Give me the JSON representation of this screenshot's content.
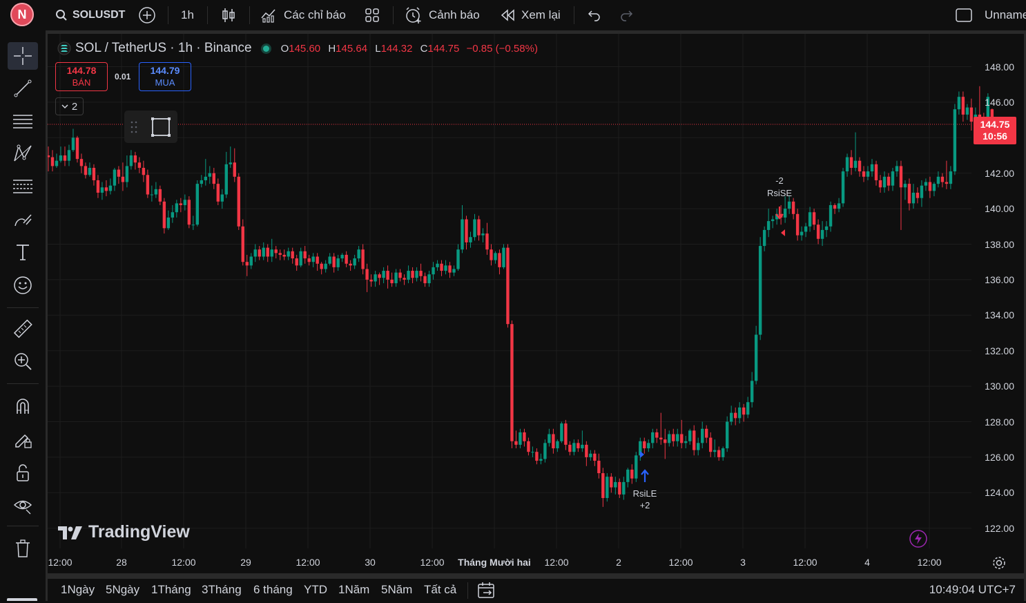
{
  "topbar": {
    "avatar_letter": "N",
    "symbol": "SOLUSDT",
    "interval": "1h",
    "indicators_label": "Các chỉ báo",
    "alerts_label": "Cảnh báo",
    "replay_label": "Xem lại",
    "layout_name": "Unname"
  },
  "legend": {
    "title": "SOL / TetherUS · 1h · Binance",
    "o_key": "O",
    "o_val": "145.60",
    "h_key": "H",
    "h_val": "145.64",
    "l_key": "L",
    "l_val": "144.32",
    "c_key": "C",
    "c_val": "144.75",
    "change": "−0.85 (−0.58%)"
  },
  "trade": {
    "sell_price": "144.78",
    "sell_label": "BÁN",
    "spread": "0.01",
    "buy_price": "144.79",
    "buy_label": "MUA",
    "indicator_count": "2"
  },
  "colors": {
    "up": "#089981",
    "down": "#f23645",
    "background": "#0f0f0f",
    "accent": "#2962ff"
  },
  "chart_data": {
    "type": "candlestick",
    "symbol": "SOL / TetherUS",
    "interval": "1h",
    "exchange": "Binance",
    "ylim": [
      121,
      149.5
    ],
    "y_ticks": [
      "148.00",
      "146.00",
      "144.00",
      "142.00",
      "140.00",
      "138.00",
      "136.00",
      "134.00",
      "132.00",
      "130.00",
      "128.00",
      "126.00",
      "124.00",
      "122.00"
    ],
    "x_ticks": [
      "12:00",
      "28",
      "12:00",
      "29",
      "12:00",
      "30",
      "12:00",
      "Tháng Mười hai",
      "12:00",
      "2",
      "12:00",
      "3",
      "12:00",
      "4",
      "12:00"
    ],
    "last_price": "144.75",
    "countdown": "10:56",
    "candles": [
      [
        143.0,
        142.9,
        142.1,
        143.5
      ],
      [
        142.9,
        142.4,
        142.1,
        143.3
      ],
      [
        142.4,
        142.7,
        142.3,
        143.1
      ],
      [
        142.7,
        143.0,
        142.6,
        143.5
      ],
      [
        143.0,
        142.7,
        142.4,
        143.5
      ],
      [
        142.7,
        143.3,
        142.4,
        143.6
      ],
      [
        143.3,
        144.0,
        143.2,
        144.5
      ],
      [
        144.0,
        142.8,
        142.6,
        144.1
      ],
      [
        142.8,
        142.4,
        142.0,
        143.1
      ],
      [
        142.4,
        141.9,
        141.7,
        142.6
      ],
      [
        141.9,
        142.3,
        141.8,
        142.6
      ],
      [
        142.3,
        141.6,
        141.3,
        142.5
      ],
      [
        141.6,
        140.9,
        140.6,
        141.9
      ],
      [
        140.9,
        141.2,
        140.5,
        141.5
      ],
      [
        141.2,
        141.0,
        140.7,
        141.6
      ],
      [
        141.0,
        141.3,
        140.8,
        141.7
      ],
      [
        141.3,
        142.2,
        141.0,
        142.3
      ],
      [
        142.2,
        141.8,
        141.4,
        142.4
      ],
      [
        141.8,
        141.5,
        141.0,
        142.6
      ],
      [
        141.5,
        142.4,
        141.2,
        143.0
      ],
      [
        142.4,
        143.0,
        142.2,
        143.3
      ],
      [
        143.0,
        142.6,
        142.2,
        143.2
      ],
      [
        142.6,
        142.3,
        142.0,
        142.9
      ],
      [
        142.3,
        141.9,
        141.5,
        142.7
      ],
      [
        141.9,
        140.8,
        140.6,
        142.2
      ],
      [
        140.8,
        140.8,
        140.4,
        141.3
      ],
      [
        140.8,
        141.1,
        140.6,
        141.5
      ],
      [
        141.1,
        140.4,
        140.2,
        141.3
      ],
      [
        140.4,
        138.9,
        138.6,
        140.6
      ],
      [
        138.9,
        139.5,
        138.8,
        139.9
      ],
      [
        139.5,
        139.8,
        139.2,
        140.2
      ],
      [
        139.8,
        140.3,
        139.5,
        140.5
      ],
      [
        140.3,
        140.2,
        139.8,
        140.6
      ],
      [
        140.2,
        140.5,
        139.9,
        140.8
      ],
      [
        140.5,
        139.1,
        138.9,
        140.7
      ],
      [
        139.1,
        139.1,
        138.8,
        139.6
      ],
      [
        139.1,
        141.4,
        139.0,
        141.6
      ],
      [
        141.4,
        141.6,
        141.2,
        141.9
      ],
      [
        141.6,
        141.8,
        141.3,
        142.8
      ],
      [
        141.8,
        142.0,
        141.4,
        142.4
      ],
      [
        142.0,
        141.4,
        141.1,
        142.3
      ],
      [
        141.4,
        140.4,
        140.2,
        141.7
      ],
      [
        140.4,
        140.8,
        140.0,
        141.1
      ],
      [
        140.8,
        142.5,
        140.6,
        143.2
      ],
      [
        142.5,
        142.6,
        142.3,
        143.5
      ],
      [
        142.6,
        141.8,
        141.5,
        143.4
      ],
      [
        141.8,
        139.0,
        138.8,
        142.0
      ],
      [
        139.0,
        137.0,
        136.8,
        139.4
      ],
      [
        137.0,
        136.8,
        136.2,
        137.4
      ],
      [
        136.8,
        137.3,
        136.6,
        137.5
      ],
      [
        137.3,
        137.7,
        137.0,
        138.0
      ],
      [
        137.7,
        137.3,
        137.1,
        137.9
      ],
      [
        137.3,
        137.8,
        137.1,
        138.1
      ],
      [
        137.8,
        137.3,
        137.0,
        138.0
      ],
      [
        137.3,
        137.7,
        137.0,
        138.3
      ],
      [
        137.7,
        137.5,
        137.2,
        137.9
      ],
      [
        137.5,
        137.4,
        137.1,
        137.7
      ],
      [
        137.4,
        137.3,
        137.1,
        137.7
      ],
      [
        137.3,
        137.6,
        137.1,
        137.8
      ],
      [
        137.6,
        137.2,
        136.9,
        137.8
      ],
      [
        137.2,
        136.8,
        136.5,
        137.4
      ],
      [
        136.8,
        137.6,
        136.7,
        137.8
      ],
      [
        137.6,
        137.2,
        136.9,
        137.9
      ],
      [
        137.2,
        137.0,
        136.8,
        137.4
      ],
      [
        137.0,
        137.3,
        136.7,
        137.5
      ],
      [
        137.3,
        136.9,
        136.5,
        137.5
      ],
      [
        136.9,
        136.6,
        136.3,
        137.0
      ],
      [
        136.6,
        136.9,
        136.4,
        137.1
      ],
      [
        136.9,
        137.3,
        136.8,
        137.5
      ],
      [
        137.3,
        136.7,
        136.4,
        137.5
      ],
      [
        136.7,
        137.2,
        136.5,
        137.4
      ],
      [
        137.2,
        137.4,
        137.0,
        137.5
      ],
      [
        137.4,
        136.9,
        136.7,
        137.6
      ],
      [
        136.9,
        136.8,
        136.5,
        137.1
      ],
      [
        136.8,
        137.2,
        136.6,
        137.4
      ],
      [
        137.2,
        137.7,
        137.0,
        137.9
      ],
      [
        137.7,
        136.6,
        136.3,
        138.0
      ],
      [
        136.6,
        136.0,
        135.3,
        136.9
      ],
      [
        136.0,
        135.9,
        135.6,
        136.3
      ],
      [
        135.9,
        136.3,
        135.6,
        136.5
      ],
      [
        136.3,
        136.1,
        135.7,
        136.4
      ],
      [
        136.1,
        136.5,
        135.8,
        136.7
      ],
      [
        136.5,
        136.0,
        135.5,
        136.8
      ],
      [
        136.0,
        135.8,
        135.6,
        136.4
      ],
      [
        135.8,
        136.4,
        135.6,
        136.6
      ],
      [
        136.4,
        136.1,
        135.9,
        136.6
      ],
      [
        136.1,
        136.0,
        135.7,
        136.3
      ],
      [
        136.0,
        136.5,
        135.8,
        136.8
      ],
      [
        136.5,
        136.1,
        135.8,
        136.7
      ],
      [
        136.1,
        136.5,
        135.9,
        136.7
      ],
      [
        136.5,
        136.2,
        135.9,
        136.9
      ],
      [
        136.2,
        135.8,
        135.6,
        136.4
      ],
      [
        135.8,
        136.3,
        135.6,
        136.5
      ],
      [
        136.3,
        136.7,
        136.0,
        137.0
      ],
      [
        136.7,
        136.9,
        136.5,
        137.1
      ],
      [
        136.9,
        136.5,
        136.2,
        137.1
      ],
      [
        136.5,
        136.8,
        136.3,
        137.1
      ],
      [
        136.8,
        136.4,
        136.1,
        137.0
      ],
      [
        136.4,
        136.6,
        136.2,
        136.8
      ],
      [
        136.6,
        137.7,
        136.5,
        138.0
      ],
      [
        137.7,
        139.4,
        137.5,
        140.2
      ],
      [
        139.4,
        138.1,
        137.7,
        139.6
      ],
      [
        138.1,
        138.4,
        137.8,
        138.7
      ],
      [
        138.4,
        139.4,
        138.2,
        139.7
      ],
      [
        139.4,
        138.5,
        138.2,
        139.6
      ],
      [
        138.5,
        138.6,
        138.1,
        138.9
      ],
      [
        138.6,
        137.7,
        137.4,
        139.2
      ],
      [
        137.7,
        137.1,
        136.8,
        138.0
      ],
      [
        137.1,
        137.5,
        136.9,
        137.6
      ],
      [
        137.5,
        136.7,
        136.3,
        137.7
      ],
      [
        136.7,
        137.8,
        136.6,
        138.0
      ],
      [
        137.8,
        133.5,
        133.3,
        138.0
      ],
      [
        133.5,
        126.9,
        126.5,
        133.7
      ],
      [
        126.9,
        126.7,
        126.5,
        127.5
      ],
      [
        126.7,
        127.4,
        126.5,
        127.6
      ],
      [
        127.4,
        126.9,
        126.6,
        127.6
      ],
      [
        126.9,
        126.3,
        126.1,
        127.1
      ],
      [
        126.3,
        126.3,
        126.0,
        126.6
      ],
      [
        126.3,
        125.8,
        125.6,
        126.5
      ],
      [
        125.8,
        125.9,
        125.6,
        126.2
      ],
      [
        125.9,
        126.8,
        125.7,
        127.0
      ],
      [
        126.8,
        127.3,
        126.6,
        127.6
      ],
      [
        127.3,
        126.5,
        126.2,
        127.6
      ],
      [
        126.5,
        126.9,
        126.3,
        127.0
      ],
      [
        126.9,
        127.9,
        126.8,
        128.0
      ],
      [
        127.9,
        126.7,
        126.4,
        128.1
      ],
      [
        126.7,
        126.3,
        126.1,
        126.9
      ],
      [
        126.3,
        126.8,
        126.1,
        127.0
      ],
      [
        126.8,
        126.5,
        126.3,
        127.0
      ],
      [
        126.5,
        126.7,
        126.3,
        127.5
      ],
      [
        126.7,
        126.0,
        125.5,
        126.9
      ],
      [
        126.0,
        126.2,
        125.8,
        126.4
      ],
      [
        126.2,
        125.8,
        125.5,
        126.4
      ],
      [
        125.8,
        125.1,
        124.8,
        126.2
      ],
      [
        125.1,
        123.7,
        123.2,
        125.4
      ],
      [
        123.7,
        124.9,
        123.5,
        125.1
      ],
      [
        124.9,
        124.3,
        124.0,
        125.1
      ],
      [
        124.3,
        124.6,
        123.9,
        124.9
      ],
      [
        124.6,
        123.9,
        123.7,
        124.8
      ],
      [
        123.9,
        124.6,
        123.6,
        124.9
      ],
      [
        124.6,
        125.3,
        124.3,
        125.4
      ],
      [
        125.3,
        124.8,
        124.5,
        125.6
      ],
      [
        124.8,
        126.1,
        124.6,
        126.3
      ],
      [
        126.1,
        126.9,
        125.8,
        127.1
      ],
      [
        126.9,
        126.5,
        126.2,
        127.1
      ],
      [
        126.5,
        126.8,
        126.3,
        127.0
      ],
      [
        126.8,
        127.4,
        126.5,
        127.6
      ],
      [
        127.4,
        127.1,
        126.8,
        127.6
      ],
      [
        127.1,
        127.0,
        126.7,
        128.5
      ],
      [
        127.0,
        126.8,
        125.9,
        127.6
      ],
      [
        126.8,
        127.3,
        126.6,
        127.5
      ],
      [
        127.3,
        126.9,
        126.6,
        127.6
      ],
      [
        126.9,
        127.3,
        126.6,
        127.6
      ],
      [
        127.3,
        126.8,
        126.5,
        128.1
      ],
      [
        126.8,
        126.9,
        126.5,
        127.2
      ],
      [
        126.9,
        127.5,
        126.7,
        127.6
      ],
      [
        127.5,
        126.4,
        126.1,
        127.8
      ],
      [
        126.4,
        126.8,
        126.1,
        127.1
      ],
      [
        126.8,
        127.6,
        126.5,
        128.0
      ],
      [
        127.6,
        127.1,
        126.8,
        127.8
      ],
      [
        127.1,
        126.3,
        126.0,
        127.4
      ],
      [
        126.3,
        126.4,
        126.0,
        127.0
      ],
      [
        126.4,
        126.0,
        125.8,
        126.6
      ],
      [
        126.0,
        126.5,
        125.8,
        126.6
      ],
      [
        126.5,
        128.0,
        126.3,
        128.3
      ],
      [
        128.0,
        128.5,
        127.8,
        128.9
      ],
      [
        128.5,
        128.2,
        127.8,
        128.8
      ],
      [
        128.2,
        128.8,
        127.9,
        129.1
      ],
      [
        128.8,
        128.4,
        128.0,
        129.0
      ],
      [
        128.4,
        129.1,
        128.2,
        129.4
      ],
      [
        129.1,
        130.3,
        128.8,
        130.8
      ],
      [
        130.3,
        132.9,
        130.1,
        133.4
      ],
      [
        132.9,
        137.9,
        132.6,
        138.4
      ],
      [
        137.9,
        138.8,
        137.6,
        139.0
      ],
      [
        138.8,
        139.3,
        138.4,
        140.0
      ],
      [
        139.3,
        139.4,
        138.9,
        139.6
      ],
      [
        139.4,
        139.7,
        139.1,
        140.0
      ],
      [
        139.7,
        139.5,
        139.1,
        140.2
      ],
      [
        139.5,
        140.0,
        139.2,
        140.7
      ],
      [
        140.0,
        140.4,
        139.7,
        140.7
      ],
      [
        140.4,
        139.7,
        139.4,
        140.6
      ],
      [
        139.7,
        138.5,
        138.2,
        140.0
      ],
      [
        138.5,
        138.7,
        138.2,
        139.0
      ],
      [
        138.7,
        139.0,
        138.4,
        139.2
      ],
      [
        139.0,
        139.8,
        138.7,
        140.1
      ],
      [
        139.8,
        139.1,
        138.8,
        140.0
      ],
      [
        139.1,
        138.3,
        138.0,
        139.4
      ],
      [
        138.3,
        138.8,
        137.9,
        139.3
      ],
      [
        138.8,
        139.0,
        138.4,
        139.3
      ],
      [
        139.0,
        140.2,
        138.7,
        140.4
      ],
      [
        140.2,
        140.0,
        139.7,
        140.3
      ],
      [
        140.0,
        140.3,
        139.8,
        140.6
      ],
      [
        140.3,
        142.1,
        140.1,
        142.3
      ],
      [
        142.1,
        142.9,
        141.8,
        143.1
      ],
      [
        142.9,
        142.3,
        141.9,
        143.3
      ],
      [
        142.3,
        142.7,
        142.1,
        144.3
      ],
      [
        142.7,
        142.1,
        141.8,
        142.9
      ],
      [
        142.1,
        141.8,
        141.5,
        142.4
      ],
      [
        141.8,
        142.1,
        141.6,
        142.4
      ],
      [
        142.1,
        142.5,
        141.8,
        142.8
      ],
      [
        142.5,
        141.6,
        141.3,
        142.7
      ],
      [
        141.6,
        141.2,
        140.9,
        141.9
      ],
      [
        141.2,
        141.8,
        140.9,
        142.1
      ],
      [
        141.8,
        141.3,
        141.0,
        142.0
      ],
      [
        141.3,
        142.1,
        141.0,
        142.3
      ],
      [
        142.1,
        142.4,
        141.8,
        142.7
      ],
      [
        142.4,
        141.2,
        138.8,
        142.7
      ],
      [
        141.2,
        141.4,
        140.5,
        141.6
      ],
      [
        141.4,
        140.3,
        139.9,
        141.7
      ],
      [
        140.3,
        140.9,
        140.0,
        141.4
      ],
      [
        140.9,
        140.6,
        140.3,
        141.2
      ],
      [
        140.6,
        141.3,
        140.1,
        141.6
      ],
      [
        141.3,
        141.5,
        141.0,
        141.7
      ],
      [
        141.5,
        141.0,
        140.6,
        141.8
      ],
      [
        141.0,
        141.4,
        140.7,
        141.5
      ],
      [
        141.4,
        141.8,
        141.2,
        142.1
      ],
      [
        141.8,
        141.5,
        141.2,
        142.0
      ],
      [
        141.5,
        141.4,
        141.1,
        142.7
      ],
      [
        141.4,
        142.1,
        141.1,
        142.4
      ],
      [
        142.1,
        145.6,
        141.9,
        145.9
      ],
      [
        145.6,
        146.3,
        145.3,
        146.6
      ],
      [
        146.3,
        145.3,
        144.9,
        146.6
      ],
      [
        145.3,
        145.7,
        145.0,
        145.9
      ],
      [
        145.7,
        144.9,
        144.4,
        146.2
      ],
      [
        144.9,
        145.3,
        144.6,
        145.7
      ],
      [
        145.3,
        145.0,
        144.5,
        146.9
      ],
      [
        145.0,
        144.5,
        144.1,
        145.4
      ],
      [
        144.5,
        146.3,
        144.3,
        146.5
      ],
      [
        145.6,
        144.75,
        144.32,
        145.64
      ]
    ],
    "signals": [
      {
        "label": "RsiLE",
        "qty": "+2",
        "side": "buy"
      },
      {
        "label": "RsiSE",
        "qty": "-2",
        "side": "sell"
      }
    ],
    "watermark": "TradingView"
  },
  "ranges": [
    "1Ngày",
    "5Ngày",
    "1Tháng",
    "3Tháng",
    "6 tháng",
    "YTD",
    "1Năm",
    "5Năm",
    "Tất cả"
  ],
  "status": {
    "clock": "10:49:04 UTC+7"
  }
}
